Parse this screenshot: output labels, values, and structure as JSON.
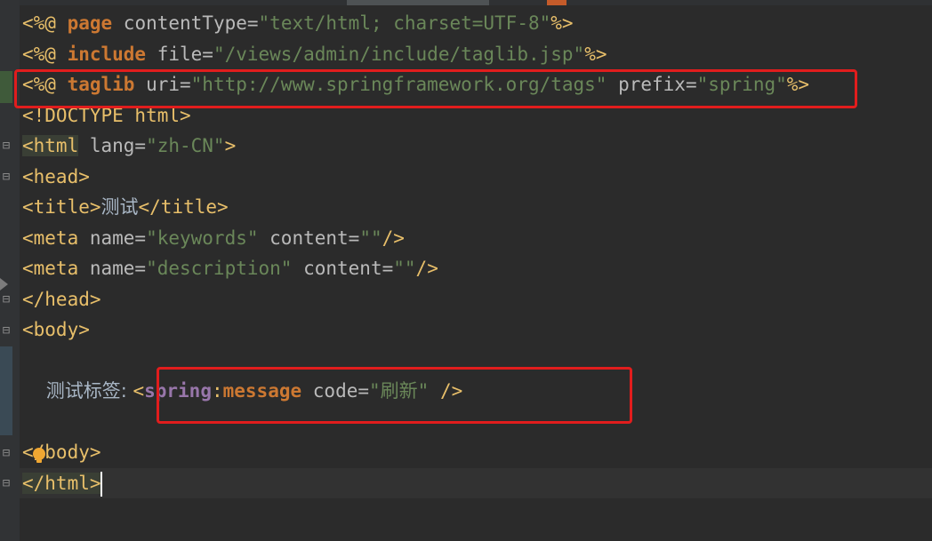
{
  "lines": [
    {
      "segs": [
        {
          "cls": "tag",
          "text": "<%@ "
        },
        {
          "cls": "kw",
          "text": "page"
        },
        {
          "cls": "attr",
          "text": " contentType="
        },
        {
          "cls": "str",
          "text": "\"text/html; charset=UTF-8\""
        },
        {
          "cls": "tag",
          "text": "%>"
        }
      ]
    },
    {
      "segs": [
        {
          "cls": "tag",
          "text": "<%@ "
        },
        {
          "cls": "kw",
          "text": "include"
        },
        {
          "cls": "attr",
          "text": " file="
        },
        {
          "cls": "str",
          "text": "\"/views/admin/include/taglib.jsp\""
        },
        {
          "cls": "tag",
          "text": "%>"
        }
      ]
    },
    {
      "segs": [
        {
          "cls": "tag",
          "text": "<%@ "
        },
        {
          "cls": "kw",
          "text": "taglib"
        },
        {
          "cls": "attr",
          "text": " uri="
        },
        {
          "cls": "url",
          "text": "\"http://www.springframework.org/tags\""
        },
        {
          "cls": "attr",
          "text": " prefix="
        },
        {
          "cls": "str",
          "text": "\"spring\""
        },
        {
          "cls": "tag",
          "text": "%>"
        }
      ]
    },
    {
      "segs": [
        {
          "cls": "tag",
          "text": "<!DOCTYPE html>"
        }
      ]
    },
    {
      "segs": [
        {
          "cls": "tag tagbg",
          "text": "<html"
        },
        {
          "cls": "attr",
          "text": " lang="
        },
        {
          "cls": "str",
          "text": "\"zh-CN\""
        },
        {
          "cls": "tag",
          "text": ">"
        }
      ]
    },
    {
      "segs": [
        {
          "cls": "tag",
          "text": "<head>"
        }
      ]
    },
    {
      "segs": [
        {
          "cls": "tag",
          "text": "<title>"
        },
        {
          "cls": "txt",
          "text": "测试"
        },
        {
          "cls": "tag",
          "text": "</title>"
        }
      ]
    },
    {
      "segs": [
        {
          "cls": "tag",
          "text": "<meta"
        },
        {
          "cls": "attr",
          "text": " name="
        },
        {
          "cls": "str",
          "text": "\"keywords\""
        },
        {
          "cls": "attr",
          "text": " content="
        },
        {
          "cls": "str",
          "text": "\"\""
        },
        {
          "cls": "tag",
          "text": "/>"
        }
      ]
    },
    {
      "segs": [
        {
          "cls": "tag",
          "text": "<meta"
        },
        {
          "cls": "attr",
          "text": " name="
        },
        {
          "cls": "str",
          "text": "\"description\""
        },
        {
          "cls": "attr",
          "text": " content="
        },
        {
          "cls": "str",
          "text": "\"\""
        },
        {
          "cls": "tag",
          "text": "/>"
        }
      ]
    },
    {
      "segs": [
        {
          "cls": "tag",
          "text": "</head>"
        }
      ]
    },
    {
      "segs": [
        {
          "cls": "tag",
          "text": "<body>"
        }
      ]
    },
    {
      "segs": []
    },
    {
      "segs": [
        {
          "cls": "txt",
          "text": "    测试标签: "
        },
        {
          "cls": "tag",
          "text": "<"
        },
        {
          "cls": "ns",
          "text": "spring"
        },
        {
          "cls": "tag",
          "text": ":"
        },
        {
          "cls": "kw",
          "text": "message"
        },
        {
          "cls": "attr",
          "text": " code="
        },
        {
          "cls": "str",
          "text": "\"刷新\""
        },
        {
          "cls": "tag",
          "text": " />"
        }
      ]
    },
    {
      "segs": []
    },
    {
      "segs": [
        {
          "cls": "tag",
          "text": "</body>"
        }
      ]
    },
    {
      "segs": [
        {
          "cls": "tag tagbg",
          "text": "</html>"
        }
      ]
    }
  ],
  "colors": {
    "highlight_box": "#e11d1d",
    "background": "#2b2b2b",
    "keyword": "#cc7832",
    "string": "#6a8759"
  }
}
